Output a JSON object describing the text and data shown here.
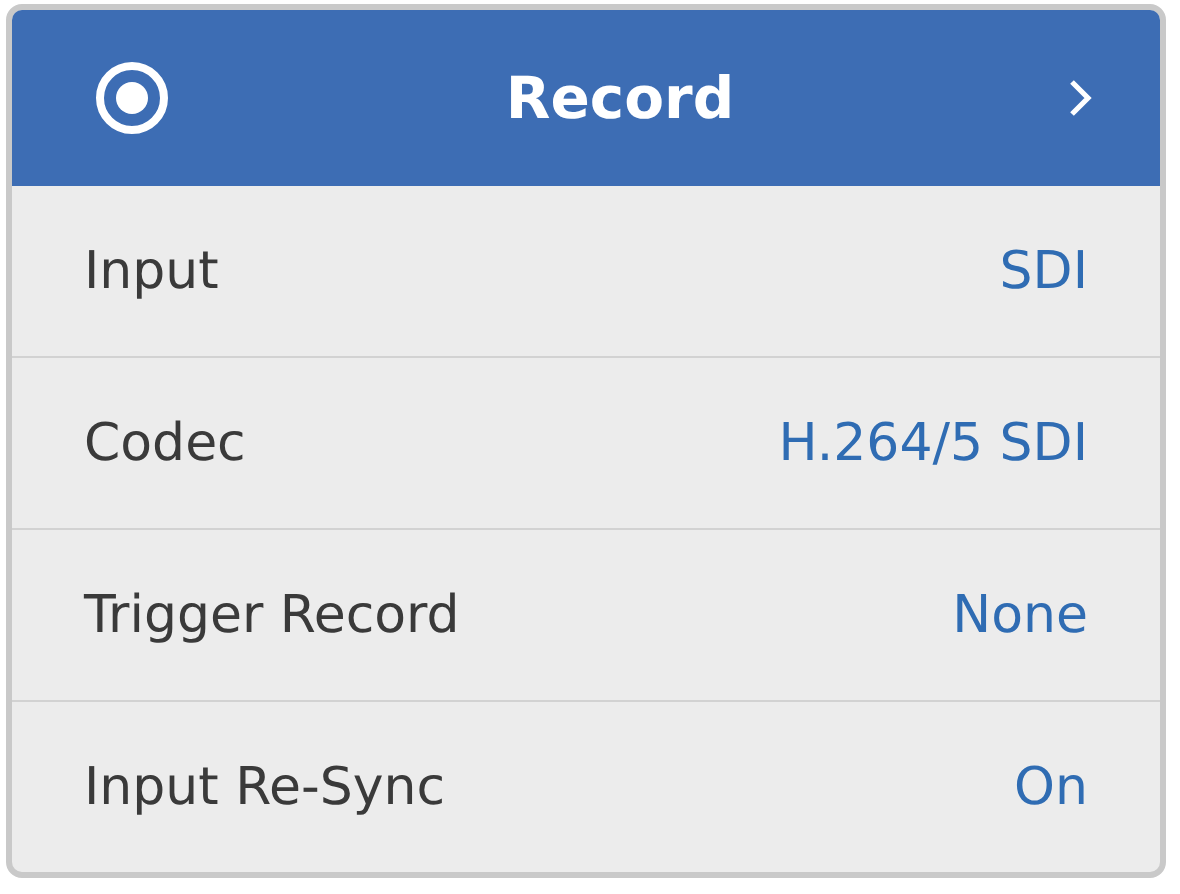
{
  "header": {
    "title": "Record"
  },
  "rows": [
    {
      "label": "Input",
      "value": "SDI"
    },
    {
      "label": "Codec",
      "value": "H.264/5 SDI"
    },
    {
      "label": "Trigger Record",
      "value": "None"
    },
    {
      "label": "Input Re-Sync",
      "value": "On"
    }
  ]
}
